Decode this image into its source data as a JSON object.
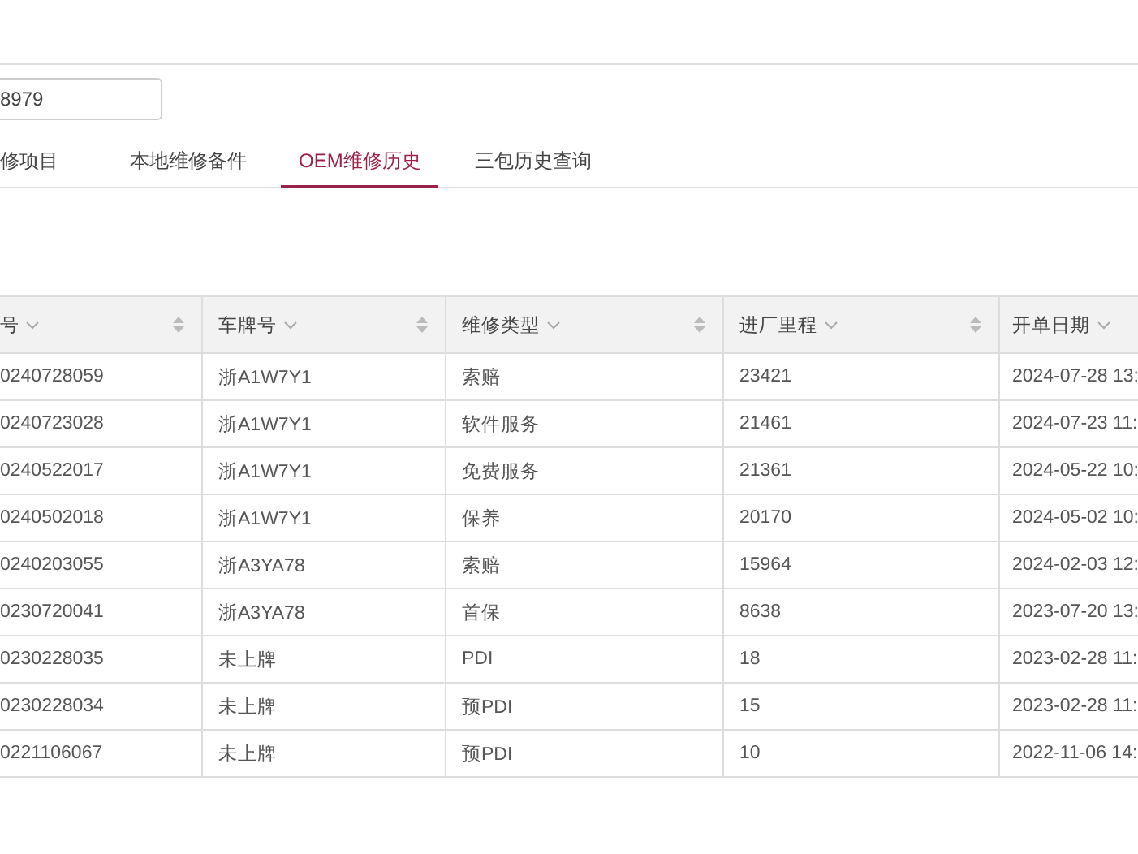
{
  "search_field": {
    "value": "8979"
  },
  "tabs": [
    {
      "label": "修项目",
      "selected": false
    },
    {
      "label": "本地维修备件",
      "selected": false
    },
    {
      "label": "OEM维修历史",
      "selected": true
    },
    {
      "label": "三包历史查询",
      "selected": false
    }
  ],
  "table": {
    "columns": [
      {
        "label": "号",
        "sortable": true
      },
      {
        "label": "车牌号",
        "sortable": true
      },
      {
        "label": "维修类型",
        "sortable": true
      },
      {
        "label": "进厂里程",
        "sortable": true
      },
      {
        "label": "开单日期",
        "sortable": false
      }
    ],
    "rows": [
      [
        "0240728059",
        "浙A1W7Y1",
        "索赔",
        "23421",
        "2024-07-28 13:"
      ],
      [
        "0240723028",
        "浙A1W7Y1",
        "软件服务",
        "21461",
        "2024-07-23 11:"
      ],
      [
        "0240522017",
        "浙A1W7Y1",
        "免费服务",
        "21361",
        "2024-05-22 10:"
      ],
      [
        "0240502018",
        "浙A1W7Y1",
        "保养",
        "20170",
        "2024-05-02 10:"
      ],
      [
        "0240203055",
        "浙A3YA78",
        "索赔",
        "15964",
        "2024-02-03 12:"
      ],
      [
        "0230720041",
        "浙A3YA78",
        "首保",
        "8638",
        "2023-07-20 13:"
      ],
      [
        "0230228035",
        "未上牌",
        "PDI",
        "18",
        "2023-02-28 11:"
      ],
      [
        "0230228034",
        "未上牌",
        "预PDI",
        "15",
        "2023-02-28 11:"
      ],
      [
        "0221106067",
        "未上牌",
        "预PDI",
        "10",
        "2022-11-06 14:"
      ]
    ]
  }
}
